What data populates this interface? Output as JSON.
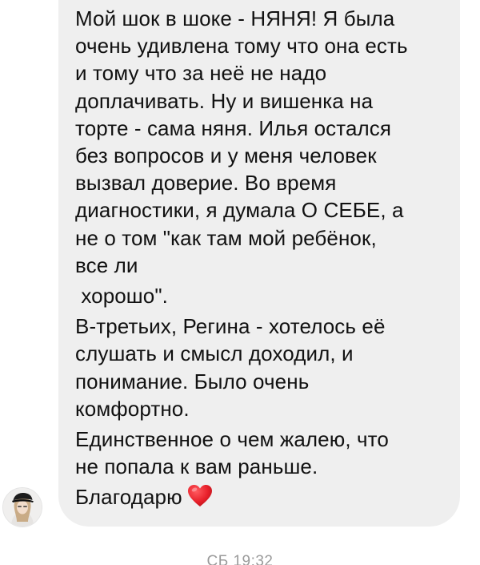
{
  "message": {
    "paragraphs": [
      {
        "lines": [
          "Мой шок в шоке - НЯНЯ! Я была",
          "очень удивлена тому что она есть",
          "и тому что за неё не надо",
          "доплачивать. Ну и вишенка на",
          "торте - сама няня. Илья остался",
          "без вопросов и у меня человек",
          "вызвал доверие. Во время",
          "диагностики, я думала О СЕБЕ, а",
          "не о том \"как там мой ребёнок,",
          "все ли"
        ]
      },
      {
        "lines": [
          " хорошо\"."
        ]
      },
      {
        "lines": [
          "В-третьих, Регина - хотелось её",
          "слушать и смысл доходил, и",
          "понимание. Было очень",
          "комфортно."
        ]
      },
      {
        "lines": [
          "Единственное о чем жалею, что",
          "не попала к вам раньше."
        ]
      }
    ],
    "closing": "Благодарю",
    "closing_emoji": "heart-icon",
    "bubble_color": "#efefef",
    "text_color": "#111111",
    "heart_color": "#e8202a"
  },
  "timestamp": "СБ 19:32",
  "timestamp_color": "#9a9a9a"
}
